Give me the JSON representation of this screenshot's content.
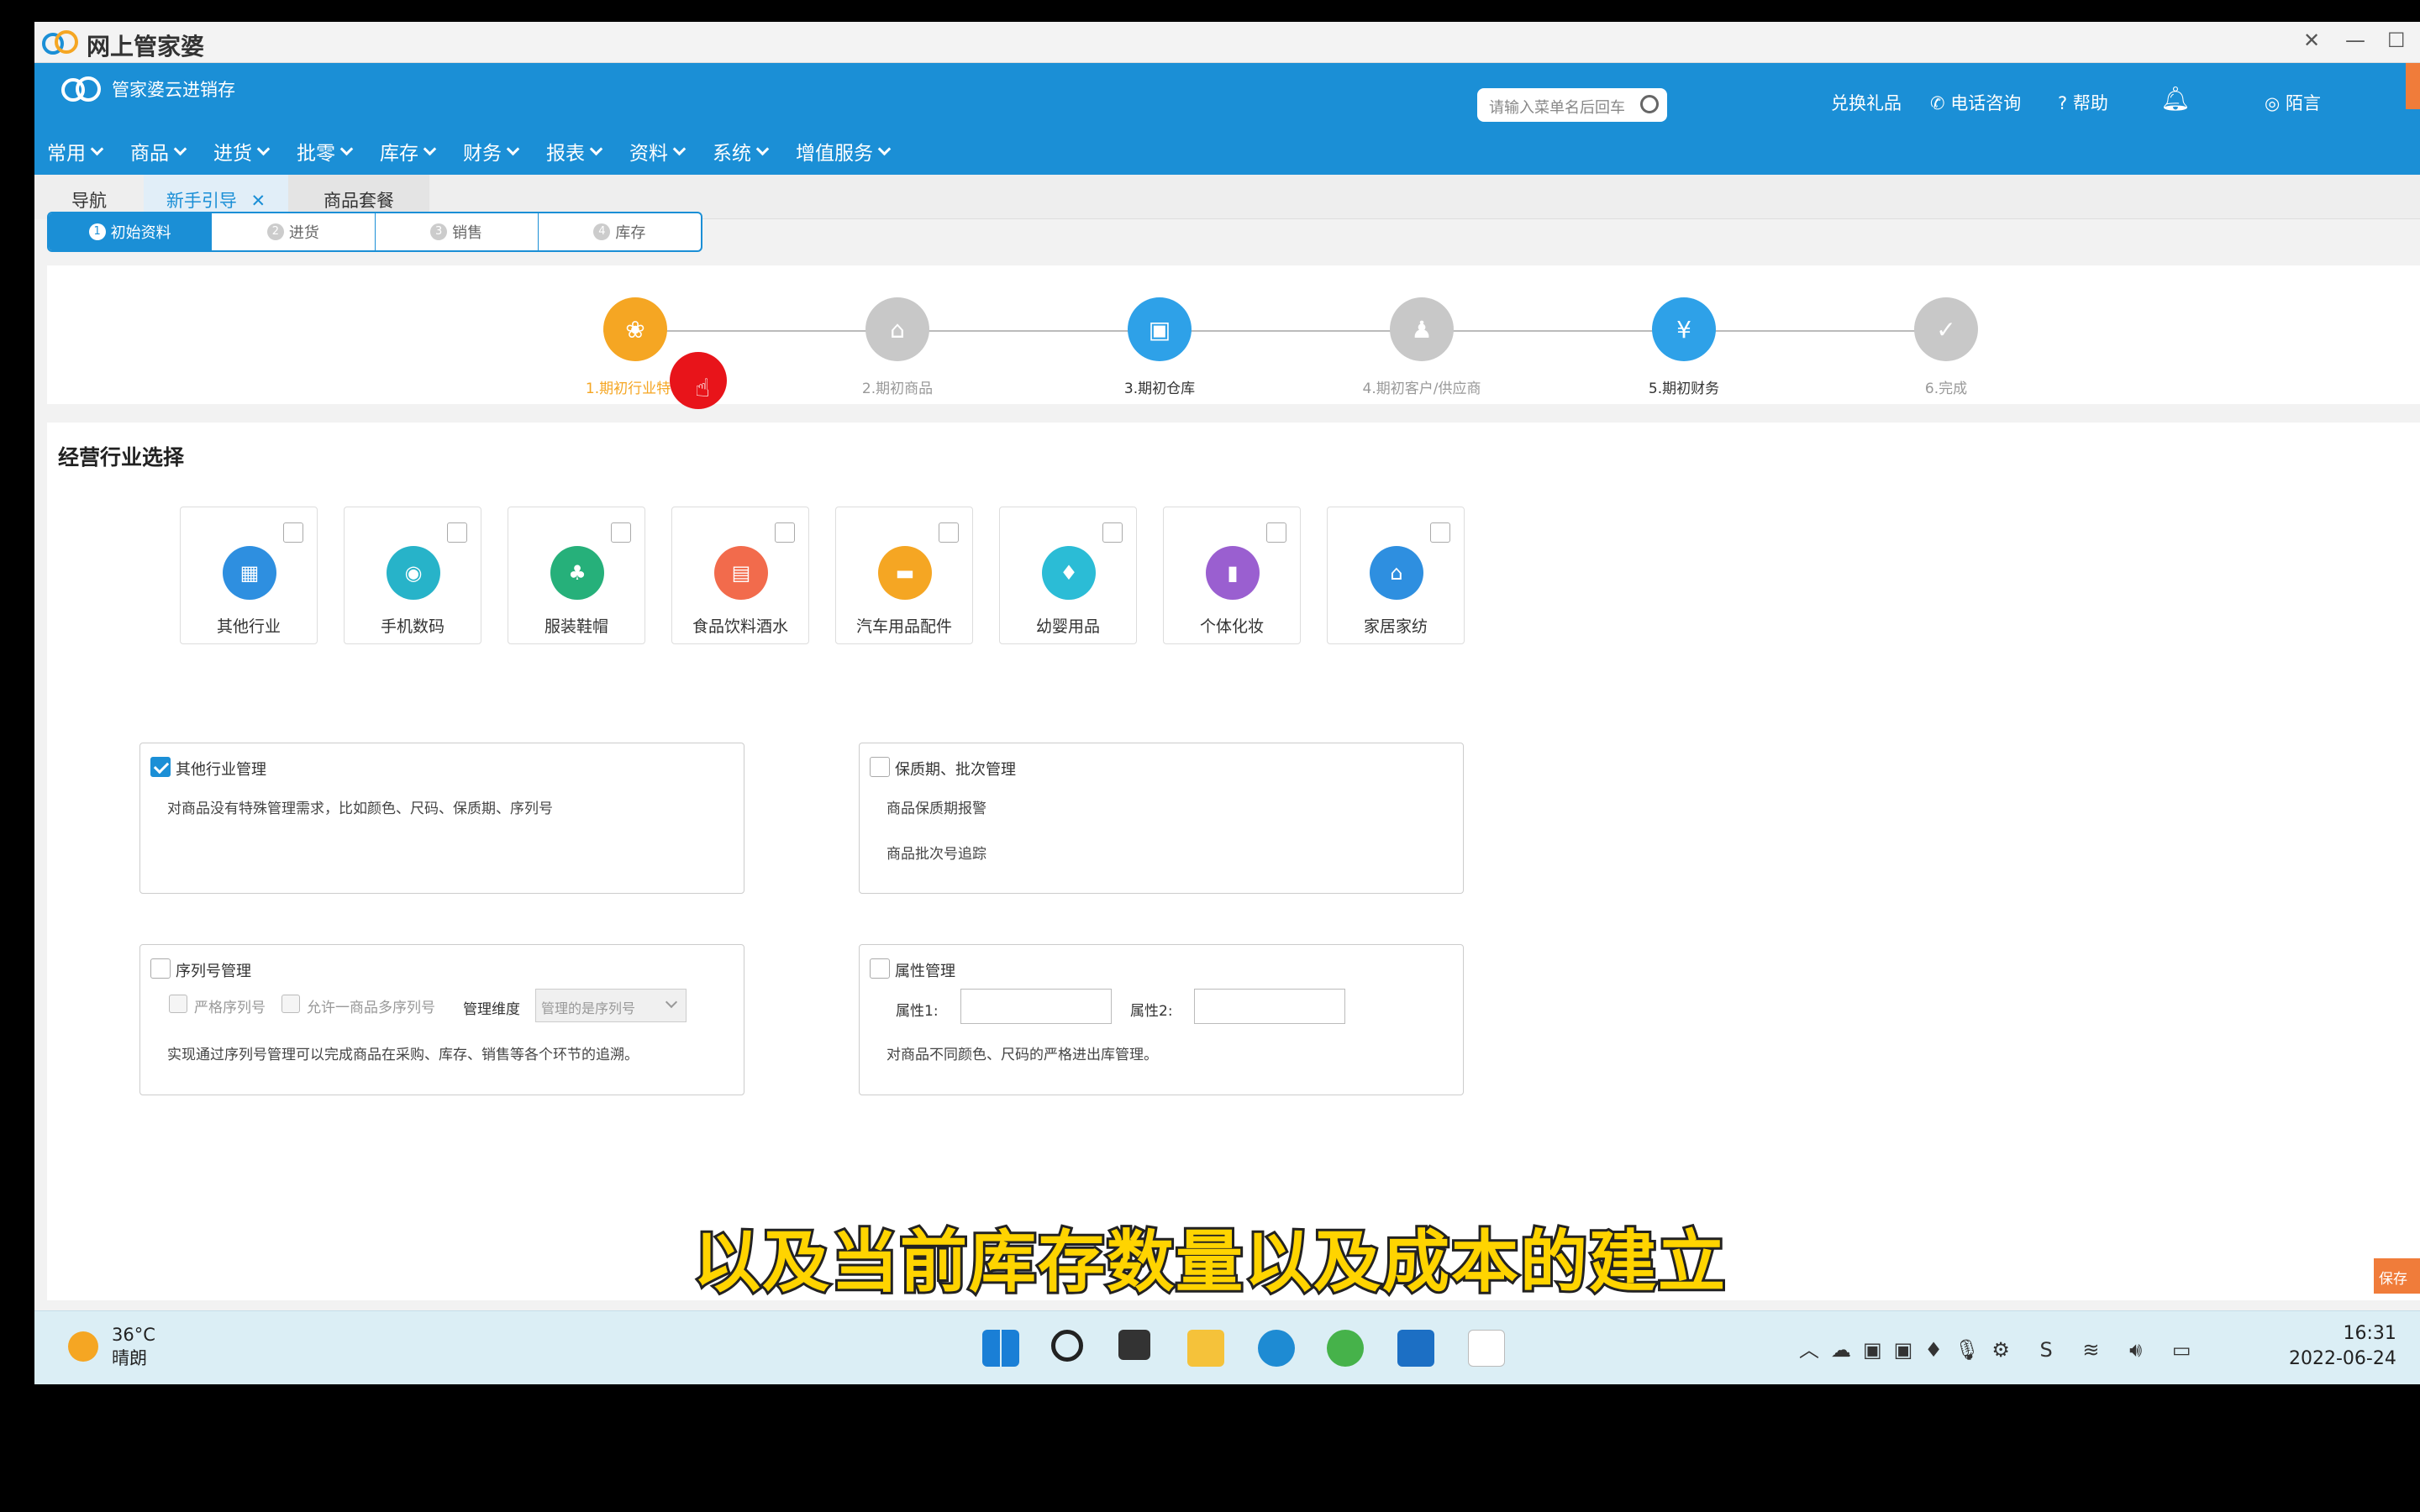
{
  "app_title": "网上管家婆",
  "brand": "管家婆云进销存",
  "search": {
    "placeholder": "请输入菜单名后回车"
  },
  "header_links": {
    "gift": "兑换礼品",
    "phone": "电话咨询",
    "help": "帮助",
    "user": "陌言"
  },
  "menu": [
    "常用",
    "商品",
    "进货",
    "批零",
    "库存",
    "财务",
    "报表",
    "资料",
    "系统",
    "增值服务"
  ],
  "tabs": [
    "导航",
    "新手引导",
    "商品套餐"
  ],
  "wizard": [
    {
      "num": "1",
      "label": "初始资料"
    },
    {
      "num": "2",
      "label": "进货"
    },
    {
      "num": "3",
      "label": "销售"
    },
    {
      "num": "4",
      "label": "库存"
    }
  ],
  "steps": [
    {
      "label": "1.期初行业特性",
      "color": "#f5a623"
    },
    {
      "label": "2.期初商品",
      "color": "#c8c8c8"
    },
    {
      "label": "3.期初仓库",
      "color": "#2ea1e8"
    },
    {
      "label": "4.期初客户/供应商",
      "color": "#c8c8c8"
    },
    {
      "label": "5.期初财务",
      "color": "#2ea1e8"
    },
    {
      "label": "6.完成",
      "color": "#c8c8c8"
    }
  ],
  "section_title": "经营行业选择",
  "industries": [
    {
      "label": "其他行业",
      "color": "#2e8fe0",
      "glyph": "▦"
    },
    {
      "label": "手机数码",
      "color": "#27b3c9",
      "glyph": "◉"
    },
    {
      "label": "服装鞋帽",
      "color": "#26b07a",
      "glyph": "♣"
    },
    {
      "label": "食品饮料酒水",
      "color": "#f26b4c",
      "glyph": "▤"
    },
    {
      "label": "汽车用品配件",
      "color": "#f5a623",
      "glyph": "▬"
    },
    {
      "label": "幼婴用品",
      "color": "#2bbcd6",
      "glyph": "♦"
    },
    {
      "label": "个体化妆",
      "color": "#9a5fd0",
      "glyph": "▮"
    },
    {
      "label": "家居家纺",
      "color": "#2e8fe0",
      "glyph": "⌂"
    }
  ],
  "boxes": {
    "other": {
      "title": "其他行业管理",
      "desc": "对商品没有特殊管理需求，比如颜色、尺码、保质期、序列号",
      "checked": true
    },
    "shelf": {
      "title": "保质期、批次管理",
      "line1": "商品保质期报警",
      "line2": "商品批次号追踪",
      "checked": false
    },
    "serial": {
      "title": "序列号管理",
      "opt1": "严格序列号",
      "opt2": "允许一商品多序列号",
      "dim_label": "管理维度",
      "dim_value": "管理的是序列号",
      "desc": "实现通过序列号管理可以完成商品在采购、库存、销售等各个环节的追溯。",
      "checked": false
    },
    "attr": {
      "title": "属性管理",
      "attr1": "属性1:",
      "attr2": "属性2:",
      "desc": "对商品不同颜色、尺码的严格进出库管理。",
      "checked": false
    }
  },
  "save_label": "保存",
  "subtitle": "以及当前库存数量以及成本的建立",
  "weather": {
    "temp": "36°C",
    "cond": "晴朗"
  },
  "clock": {
    "time": "16:31",
    "date": "2022-06-24"
  }
}
